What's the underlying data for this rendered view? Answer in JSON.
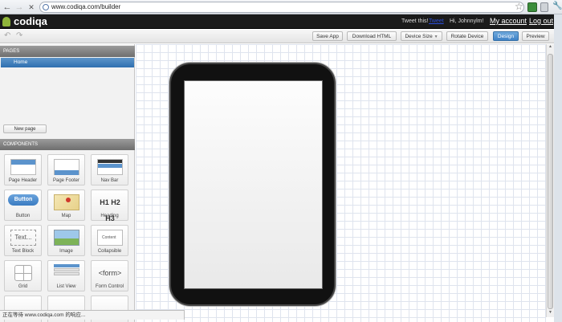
{
  "browser": {
    "url": "www.codiqa.com/builder",
    "back_glyph": "←",
    "forward_glyph": "→",
    "stop_glyph": "✕",
    "star_glyph": "☆",
    "wrench_glyph": "🔧"
  },
  "header": {
    "logo": "codiqa",
    "tweet": "Tweet this!",
    "tweet_link": "Tweet",
    "greeting": "Hi, Johnnylm!",
    "my_account": "My account",
    "logout": "Log out"
  },
  "toolbar": {
    "undo_glyph": "↶",
    "redo_glyph": "↷",
    "save_app": "Save App",
    "download_html": "Download HTML",
    "device_size": "Device Size",
    "rotate_device": "Rotate Device",
    "design": "Design",
    "preview": "Preview"
  },
  "sidebar": {
    "pages_title": "PAGES",
    "home": "Home",
    "new_page": "New page",
    "components_title": "COMPONENTS",
    "components": [
      {
        "label": "Page Header"
      },
      {
        "label": "Page Footer"
      },
      {
        "label": "Nav Bar"
      },
      {
        "label": "Button",
        "icon_text": "Button"
      },
      {
        "label": "Map"
      },
      {
        "label": "Heading",
        "icon_text": "H1 H2 H3"
      },
      {
        "label": "Text Block",
        "icon_text": "Text..."
      },
      {
        "label": "Image"
      },
      {
        "label": "Collapsible",
        "icon_text": "Content"
      },
      {
        "label": "Grid"
      },
      {
        "label": "List View"
      },
      {
        "label": "Form Control",
        "icon_text": "<form>"
      }
    ]
  },
  "status": "正在等待 www.codiqa.com 的响应...",
  "colors": {
    "accent": "#3f82c7",
    "header_bg": "#1b1b1b",
    "logo_green": "#8fb43a"
  }
}
